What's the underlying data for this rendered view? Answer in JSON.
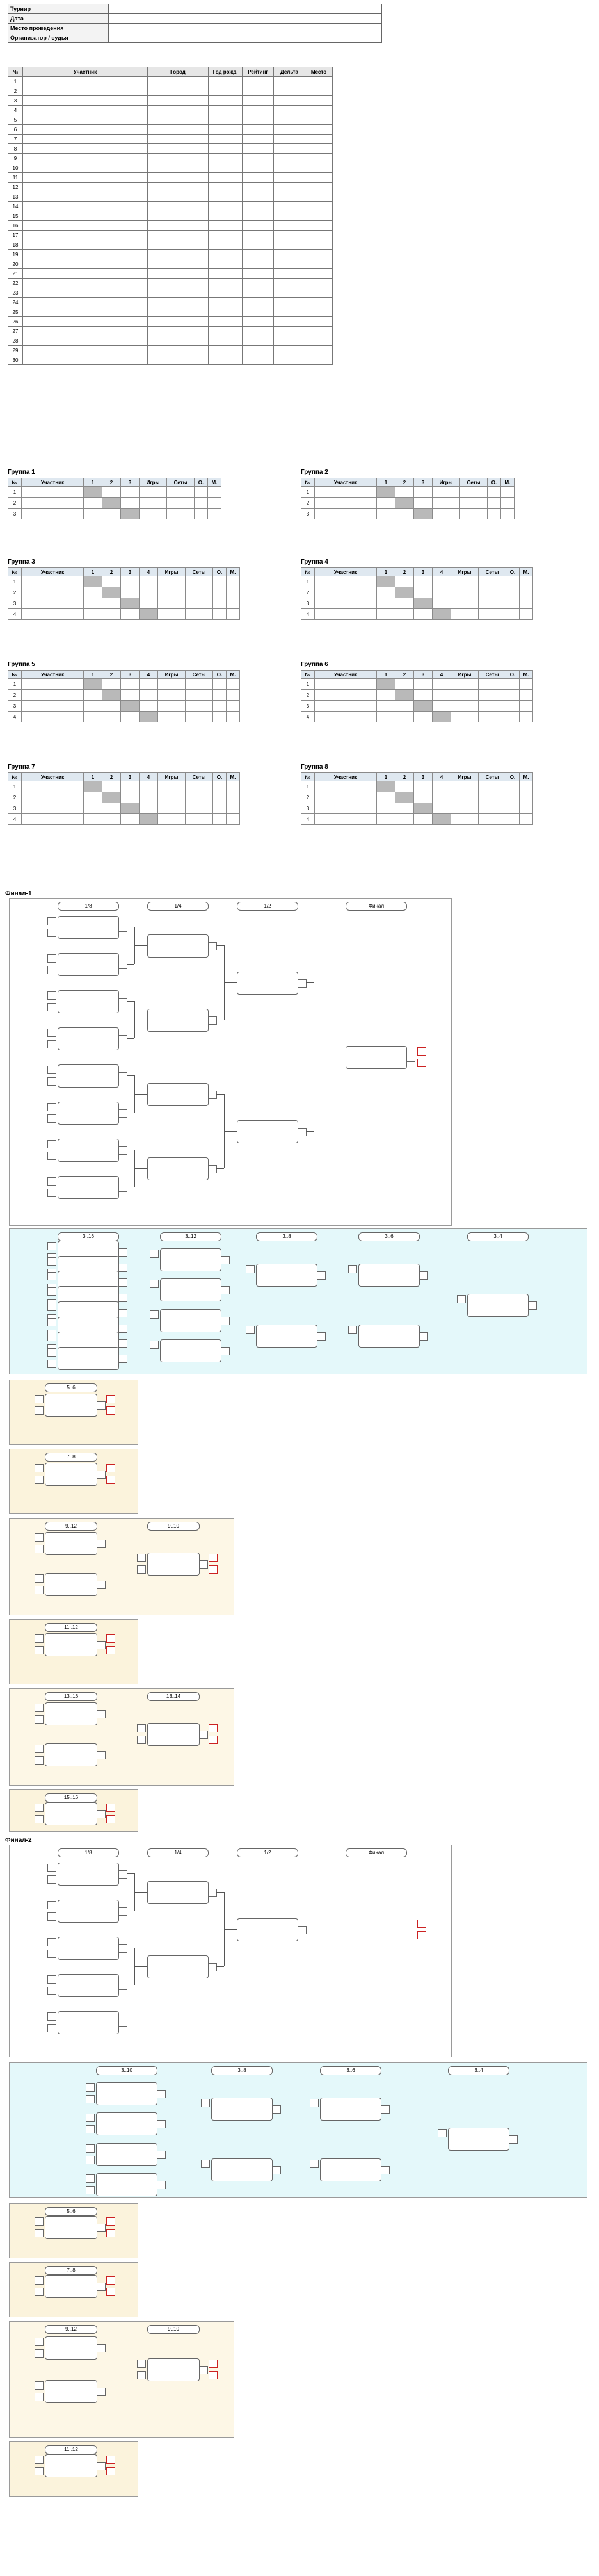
{
  "info": {
    "rows": [
      {
        "label": "Турнир",
        "value": ""
      },
      {
        "label": "Дата",
        "value": ""
      },
      {
        "label": "Место проведения",
        "value": ""
      },
      {
        "label": "Организатор / судья",
        "value": ""
      }
    ]
  },
  "participants": {
    "headers": [
      "№",
      "Участник",
      "Город",
      "Год рожд.",
      "Рейтинг",
      "Дельта",
      "Место"
    ],
    "rows": [
      {
        "n": "1",
        "name": "",
        "city": "",
        "year": "",
        "rating": "",
        "delta": "",
        "place": ""
      },
      {
        "n": "2",
        "name": "",
        "city": "",
        "year": "",
        "rating": "",
        "delta": "",
        "place": ""
      },
      {
        "n": "3",
        "name": "",
        "city": "",
        "year": "",
        "rating": "",
        "delta": "",
        "place": ""
      },
      {
        "n": "4",
        "name": "",
        "city": "",
        "year": "",
        "rating": "",
        "delta": "",
        "place": ""
      },
      {
        "n": "5",
        "name": "",
        "city": "",
        "year": "",
        "rating": "",
        "delta": "",
        "place": ""
      },
      {
        "n": "6",
        "name": "",
        "city": "",
        "year": "",
        "rating": "",
        "delta": "",
        "place": ""
      },
      {
        "n": "7",
        "name": "",
        "city": "",
        "year": "",
        "rating": "",
        "delta": "",
        "place": ""
      },
      {
        "n": "8",
        "name": "",
        "city": "",
        "year": "",
        "rating": "",
        "delta": "",
        "place": ""
      },
      {
        "n": "9",
        "name": "",
        "city": "",
        "year": "",
        "rating": "",
        "delta": "",
        "place": ""
      },
      {
        "n": "10",
        "name": "",
        "city": "",
        "year": "",
        "rating": "",
        "delta": "",
        "place": ""
      },
      {
        "n": "11",
        "name": "",
        "city": "",
        "year": "",
        "rating": "",
        "delta": "",
        "place": ""
      },
      {
        "n": "12",
        "name": "",
        "city": "",
        "year": "",
        "rating": "",
        "delta": "",
        "place": ""
      },
      {
        "n": "13",
        "name": "",
        "city": "",
        "year": "",
        "rating": "",
        "delta": "",
        "place": ""
      },
      {
        "n": "14",
        "name": "",
        "city": "",
        "year": "",
        "rating": "",
        "delta": "",
        "place": ""
      },
      {
        "n": "15",
        "name": "",
        "city": "",
        "year": "",
        "rating": "",
        "delta": "",
        "place": ""
      },
      {
        "n": "16",
        "name": "",
        "city": "",
        "year": "",
        "rating": "",
        "delta": "",
        "place": ""
      },
      {
        "n": "17",
        "name": "",
        "city": "",
        "year": "",
        "rating": "",
        "delta": "",
        "place": ""
      },
      {
        "n": "18",
        "name": "",
        "city": "",
        "year": "",
        "rating": "",
        "delta": "",
        "place": ""
      },
      {
        "n": "19",
        "name": "",
        "city": "",
        "year": "",
        "rating": "",
        "delta": "",
        "place": ""
      },
      {
        "n": "20",
        "name": "",
        "city": "",
        "year": "",
        "rating": "",
        "delta": "",
        "place": ""
      },
      {
        "n": "21",
        "name": "",
        "city": "",
        "year": "",
        "rating": "",
        "delta": "",
        "place": ""
      },
      {
        "n": "22",
        "name": "",
        "city": "",
        "year": "",
        "rating": "",
        "delta": "",
        "place": ""
      },
      {
        "n": "23",
        "name": "",
        "city": "",
        "year": "",
        "rating": "",
        "delta": "",
        "place": ""
      },
      {
        "n": "24",
        "name": "",
        "city": "",
        "year": "",
        "rating": "",
        "delta": "",
        "place": ""
      },
      {
        "n": "25",
        "name": "",
        "city": "",
        "year": "",
        "rating": "",
        "delta": "",
        "place": ""
      },
      {
        "n": "26",
        "name": "",
        "city": "",
        "year": "",
        "rating": "",
        "delta": "",
        "place": ""
      },
      {
        "n": "27",
        "name": "",
        "city": "",
        "year": "",
        "rating": "",
        "delta": "",
        "place": ""
      },
      {
        "n": "28",
        "name": "",
        "city": "",
        "year": "",
        "rating": "",
        "delta": "",
        "place": ""
      },
      {
        "n": "29",
        "name": "",
        "city": "",
        "year": "",
        "rating": "",
        "delta": "",
        "place": ""
      },
      {
        "n": "30",
        "name": "",
        "city": "",
        "year": "",
        "rating": "",
        "delta": "",
        "place": ""
      }
    ]
  },
  "groups": {
    "headers": [
      "№",
      "Участник",
      "1",
      "2",
      "3",
      "4",
      "Игры",
      "Сеты",
      "О.",
      "М."
    ],
    "list": [
      {
        "title": "Группа 1",
        "rows": [
          {
            "n": "1",
            "name": ""
          },
          {
            "n": "2",
            "name": ""
          },
          {
            "n": "3",
            "name": ""
          }
        ]
      },
      {
        "title": "Группа 2",
        "rows": [
          {
            "n": "1",
            "name": ""
          },
          {
            "n": "2",
            "name": ""
          },
          {
            "n": "3",
            "name": ""
          }
        ]
      },
      {
        "title": "Группа 3",
        "rows": [
          {
            "n": "1",
            "name": ""
          },
          {
            "n": "2",
            "name": ""
          },
          {
            "n": "3",
            "name": ""
          },
          {
            "n": "4",
            "name": ""
          }
        ]
      },
      {
        "title": "Группа 4",
        "rows": [
          {
            "n": "1",
            "name": ""
          },
          {
            "n": "2",
            "name": ""
          },
          {
            "n": "3",
            "name": ""
          },
          {
            "n": "4",
            "name": ""
          }
        ]
      },
      {
        "title": "Группа 5",
        "rows": [
          {
            "n": "1",
            "name": ""
          },
          {
            "n": "2",
            "name": ""
          },
          {
            "n": "3",
            "name": ""
          },
          {
            "n": "4",
            "name": ""
          }
        ]
      },
      {
        "title": "Группа 6",
        "rows": [
          {
            "n": "1",
            "name": ""
          },
          {
            "n": "2",
            "name": ""
          },
          {
            "n": "3",
            "name": ""
          },
          {
            "n": "4",
            "name": ""
          }
        ]
      },
      {
        "title": "Группа 7",
        "rows": [
          {
            "n": "1",
            "name": ""
          },
          {
            "n": "2",
            "name": ""
          },
          {
            "n": "3",
            "name": ""
          },
          {
            "n": "4",
            "name": ""
          }
        ]
      },
      {
        "title": "Группа 8",
        "rows": [
          {
            "n": "1",
            "name": ""
          },
          {
            "n": "2",
            "name": ""
          },
          {
            "n": "3",
            "name": ""
          },
          {
            "n": "4",
            "name": ""
          }
        ]
      }
    ]
  },
  "final1": {
    "title": "Финал-1",
    "rounds_main": [
      "1/8",
      "1/4",
      "1/2",
      "Финал"
    ],
    "rounds_cons": [
      "3..16",
      "3..12",
      "3..8",
      "3..6",
      "3..4"
    ],
    "small_rounds": [
      "5..6",
      "7..8",
      "9..12",
      "9..10",
      "11..12",
      "13..16",
      "13..14",
      "15..16"
    ]
  },
  "final2": {
    "title": "Финал-2",
    "rounds_main": [
      "1/8",
      "1/4",
      "1/2",
      "Финал"
    ],
    "rounds_cons": [
      "3..10",
      "3..8",
      "3..6",
      "3..4"
    ],
    "small_rounds": [
      "5..6",
      "7..8",
      "9..12",
      "9..10",
      "11..12"
    ]
  }
}
